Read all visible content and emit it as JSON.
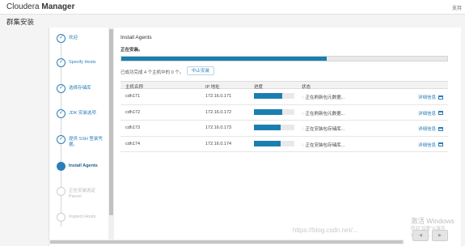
{
  "app": {
    "brand_light": "Cloudera ",
    "brand_bold": "Manager",
    "top_right": "支持"
  },
  "page_title": "群集安装",
  "steps": [
    {
      "label": "欢迎",
      "state": "done"
    },
    {
      "label": "Specify Hosts",
      "state": "done"
    },
    {
      "label": "选择存储库",
      "state": "done"
    },
    {
      "label": "JDK 安装选项",
      "state": "done"
    },
    {
      "label": "提供 SSH 登录凭据。",
      "state": "done"
    },
    {
      "label": "Install Agents",
      "state": "active"
    },
    {
      "label": "正在安装选定 Parcel",
      "state": "pending"
    },
    {
      "label": "Inspect Hosts",
      "state": "pending"
    }
  ],
  "main": {
    "title": "Install Agents",
    "installing_label": "正在安装。",
    "overall_progress": 0.63,
    "summary": "已成功完成 4 个主机中的 0 个。",
    "abort_label": "中止安装",
    "columns": [
      "主机名称",
      "IP 地址",
      "进度",
      "状态"
    ],
    "rows": [
      {
        "host": "cdh171",
        "ip": "172.16.0.171",
        "progress": 0.7,
        "status": "正在刷新包元数据...",
        "detail": "详细信息"
      },
      {
        "host": "cdh172",
        "ip": "172.16.0.172",
        "progress": 0.7,
        "status": "正在刷新包元数据...",
        "detail": "详细信息"
      },
      {
        "host": "cdh173",
        "ip": "172.16.0.173",
        "progress": 0.66,
        "status": "正在安装包存储库...",
        "detail": "详细信息"
      },
      {
        "host": "cdh174",
        "ip": "172.16.0.174",
        "progress": 0.66,
        "status": "正在安装包存储库...",
        "detail": "详细信息"
      }
    ]
  },
  "watermark": {
    "line1": "激活 Windows",
    "line2": "转到\"设置\"以激活 Windows。",
    "blog": "https://blog.csdn.net/..."
  },
  "colors": {
    "accent": "#2a7fb8",
    "progress": "#1a7fb0"
  }
}
